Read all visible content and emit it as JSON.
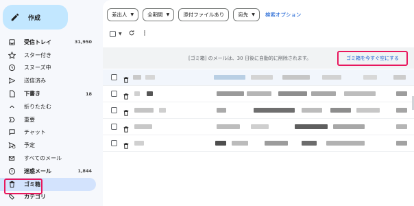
{
  "sidebar": {
    "compose_label": "作成",
    "items": [
      {
        "label": "受信トレイ",
        "count": "31,950",
        "icon": "inbox-icon",
        "bold": true
      },
      {
        "label": "スター付き",
        "count": "",
        "icon": "star-icon"
      },
      {
        "label": "スヌーズ中",
        "count": "",
        "icon": "clock-icon"
      },
      {
        "label": "送信済み",
        "count": "",
        "icon": "send-icon"
      },
      {
        "label": "下書き",
        "count": "18",
        "icon": "draft-icon",
        "bold": true
      },
      {
        "label": "折りたたむ",
        "count": "",
        "icon": "chevron-up-icon"
      },
      {
        "label": "重要",
        "count": "",
        "icon": "important-icon"
      },
      {
        "label": "チャット",
        "count": "",
        "icon": "chat-icon"
      },
      {
        "label": "予定",
        "count": "",
        "icon": "scheduled-icon"
      },
      {
        "label": "すべてのメール",
        "count": "",
        "icon": "all-mail-icon"
      },
      {
        "label": "迷惑メール",
        "count": "1,844",
        "icon": "spam-icon",
        "bold": true
      },
      {
        "label": "ゴミ箱",
        "count": "",
        "icon": "trash-icon",
        "active": true
      },
      {
        "label": "カテゴリ",
        "count": "",
        "icon": "category-icon",
        "bold": true
      }
    ]
  },
  "filters": {
    "from": "差出人",
    "any_time": "全期間",
    "has_attachment": "添付ファイルあり",
    "to": "宛先",
    "advanced_search": "検索オプション"
  },
  "banner": {
    "message": "[ゴミ箱] のメールは、30 日後に自動的に削除されます。",
    "empty_trash_now": "ゴミ箱を今すぐ空にする"
  },
  "colors": {
    "compose_bg": "#c2e7ff",
    "active_bg": "#d3e3fd",
    "highlight": "#e8175d",
    "link": "#0b57d0"
  }
}
